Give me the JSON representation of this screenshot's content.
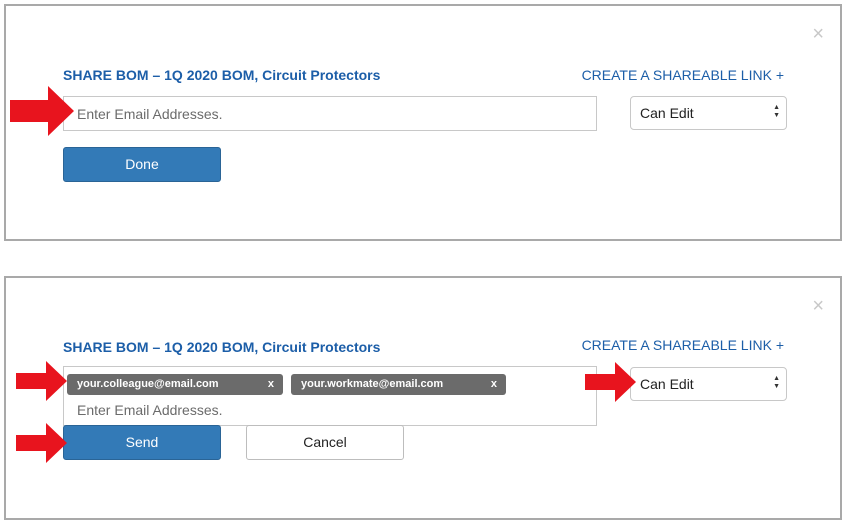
{
  "colors": {
    "accent": "#1c5ea8",
    "primary_button": "#337ab7",
    "tag": "#6b6b6b",
    "arrow": "#e8141e"
  },
  "panel1": {
    "close_glyph": "×",
    "title": "SHARE BOM – 1Q 2020 BOM, Circuit Protectors",
    "share_link": "CREATE A SHAREABLE LINK +",
    "email_placeholder": "Enter Email Addresses.",
    "permission": "Can Edit",
    "done_label": "Done"
  },
  "panel2": {
    "close_glyph": "×",
    "title": "SHARE BOM – 1Q 2020 BOM, Circuit Protectors",
    "share_link": "CREATE A SHAREABLE LINK +",
    "recipients": [
      {
        "email": "your.colleague@email.com",
        "remove": "x"
      },
      {
        "email": "your.workmate@email.com",
        "remove": "x"
      }
    ],
    "email_placeholder": "Enter Email Addresses.",
    "permission": "Can Edit",
    "send_label": "Send",
    "cancel_label": "Cancel"
  }
}
